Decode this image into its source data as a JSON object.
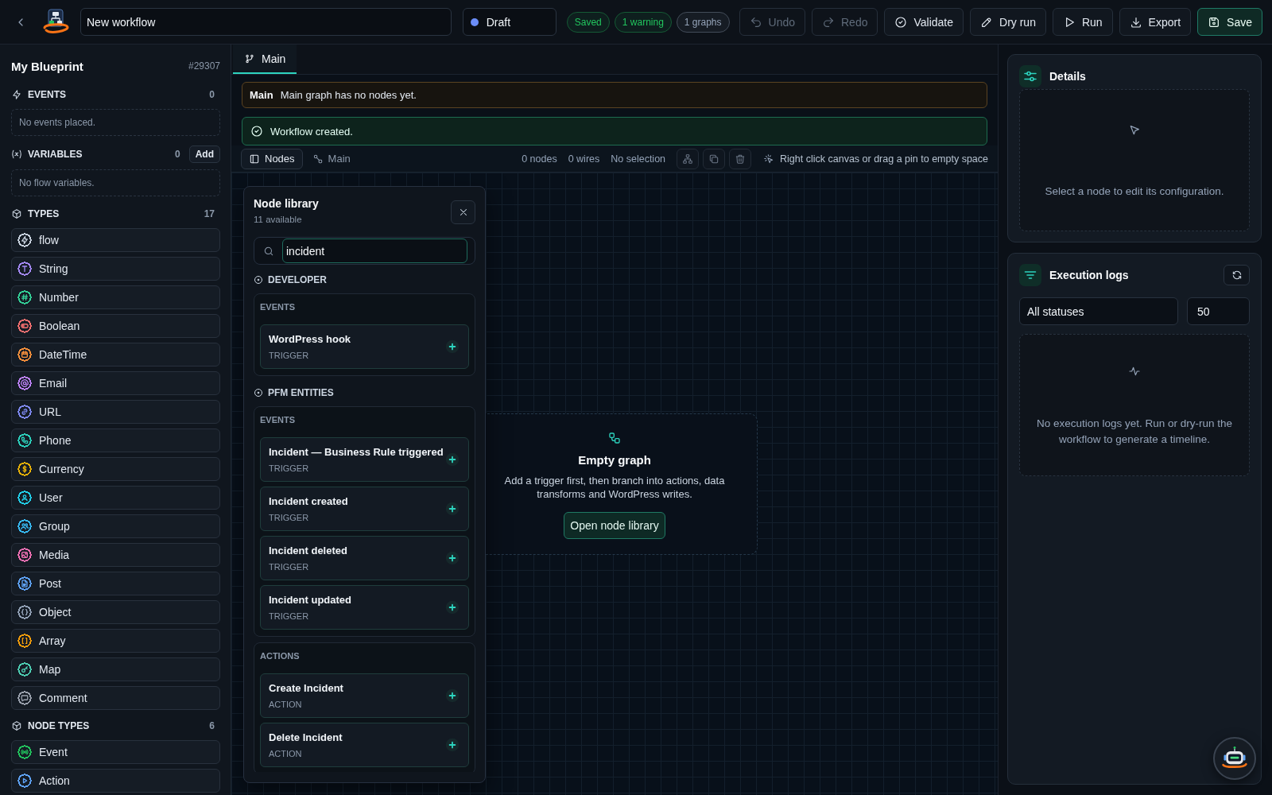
{
  "top_bar": {
    "title_field": {
      "value": "New workflow"
    },
    "status_select": {
      "value": "Draft"
    },
    "badges": [
      {
        "label": "Saved",
        "color": "#22c55e"
      },
      {
        "label": "1 warning",
        "color": "#22c55e"
      },
      {
        "label": "1 graphs",
        "color": "#94a3b8"
      }
    ],
    "buttons": [
      {
        "label": "Undo",
        "kind": "default",
        "disabled": true
      },
      {
        "label": "Redo",
        "kind": "default",
        "disabled": true
      },
      {
        "label": "Validate",
        "kind": "default",
        "disabled": false
      },
      {
        "label": "Dry run",
        "kind": "default",
        "disabled": false
      },
      {
        "label": "Run",
        "kind": "default",
        "disabled": false
      },
      {
        "label": "Export",
        "kind": "default",
        "disabled": false
      },
      {
        "label": "Save",
        "kind": "primary",
        "disabled": false
      }
    ]
  },
  "sidebar": {
    "title": "My Blueprint",
    "id": "#29307",
    "events": {
      "heading": "EVENTS",
      "count": "0",
      "empty_text": "No events placed."
    },
    "variables": {
      "heading": "VARIABLES",
      "count": "0",
      "add_button": "Add",
      "empty_text": "No flow variables."
    },
    "types": {
      "heading": "TYPES",
      "count": "17",
      "items": [
        {
          "label": "flow",
          "color": "#cbd5e1"
        },
        {
          "label": "String",
          "color": "#a78bfa"
        },
        {
          "label": "Number",
          "color": "#34d399"
        },
        {
          "label": "Boolean",
          "color": "#f87171"
        },
        {
          "label": "DateTime",
          "color": "#fb923c"
        },
        {
          "label": "Email",
          "color": "#c084fc"
        },
        {
          "label": "URL",
          "color": "#818cf8"
        },
        {
          "label": "Phone",
          "color": "#2dd4bf"
        },
        {
          "label": "Currency",
          "color": "#eab308"
        },
        {
          "label": "User",
          "color": "#22d3ee"
        },
        {
          "label": "Group",
          "color": "#38bdf8"
        },
        {
          "label": "Media",
          "color": "#f472b6"
        },
        {
          "label": "Post",
          "color": "#60a5fa"
        },
        {
          "label": "Object",
          "color": "#94a3b8"
        },
        {
          "label": "Array",
          "color": "#f59e0b"
        },
        {
          "label": "Map",
          "color": "#4fd1b5"
        },
        {
          "label": "Comment",
          "color": "#9ca3af"
        }
      ]
    },
    "node_types": {
      "heading": "NODE TYPES",
      "count": "6",
      "items": [
        {
          "label": "Event",
          "color": "#22c55e"
        },
        {
          "label": "Action",
          "color": "#60a5fa"
        }
      ]
    }
  },
  "graph_tabs": [
    {
      "label": "Main",
      "selected": true
    }
  ],
  "notice": {
    "title": "Main",
    "message": "Main graph has no nodes yet."
  },
  "toast": {
    "message": "Workflow created."
  },
  "toolbar": {
    "nodes_toggle": {
      "label": "Nodes",
      "on": true
    },
    "graph_link": "Main",
    "stats": [
      "0 nodes",
      "0 wires",
      "No selection"
    ],
    "hint": "Right click canvas or drag a pin to empty space"
  },
  "canvas": {
    "empty_state": {
      "title": "Empty graph",
      "text": "Add a trigger first, then branch into actions, data transforms and WordPress writes.",
      "button": "Open node library"
    }
  },
  "node_library": {
    "title": "Node library",
    "count": "11 available",
    "search": {
      "value": "incident"
    },
    "groups": [
      {
        "name": "DEVELOPER",
        "sections": [
          {
            "heading": "EVENTS",
            "nodes": [
              {
                "title": "WordPress hook",
                "type": "TRIGGER"
              }
            ]
          }
        ]
      },
      {
        "name": "PFM ENTITIES",
        "sections": [
          {
            "heading": "EVENTS",
            "nodes": [
              {
                "title": "Incident — Business Rule triggered",
                "type": "TRIGGER"
              },
              {
                "title": "Incident created",
                "type": "TRIGGER"
              },
              {
                "title": "Incident deleted",
                "type": "TRIGGER"
              },
              {
                "title": "Incident updated",
                "type": "TRIGGER"
              }
            ]
          },
          {
            "heading": "ACTIONS",
            "nodes": [
              {
                "title": "Create Incident",
                "type": "ACTION"
              },
              {
                "title": "Delete Incident",
                "type": "ACTION"
              }
            ]
          }
        ]
      }
    ]
  },
  "details": {
    "title": "Details",
    "empty_text": "Select a node to edit its configuration."
  },
  "execution_logs": {
    "title": "Execution logs",
    "status_filter": {
      "value": "All statuses"
    },
    "limit_field": {
      "value": "50"
    },
    "empty_text": "No execution logs yet. Run or dry-run the workflow to generate a timeline."
  }
}
